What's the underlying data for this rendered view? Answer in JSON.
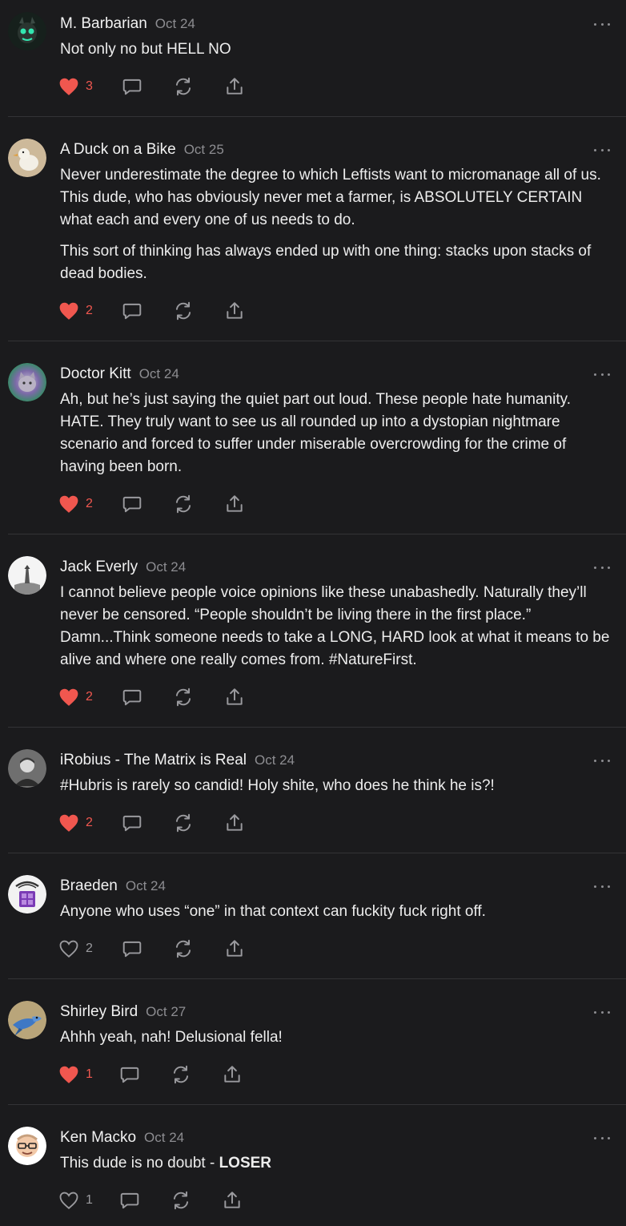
{
  "colors": {
    "background": "#1b1b1d",
    "liked_heart": "#f0574f",
    "icon_gray": "#9a9a9e",
    "date_gray": "#8d8d91",
    "divider": "#333336"
  },
  "comments": [
    {
      "author": "M. Barbarian",
      "date": "Oct 24",
      "paragraphs": [
        "Not only no but HELL NO"
      ],
      "likes": "3",
      "liked": true,
      "avatar": "skull-glow-avatar"
    },
    {
      "author": "A Duck on a Bike",
      "date": "Oct 25",
      "paragraphs": [
        "Never underestimate the degree to which Leftists want to micromanage all of us. This dude, who has obviously never met a farmer, is ABSOLUTELY CERTAIN what each and every one of us needs to do.",
        "This sort of thinking has always ended up with one thing: stacks upon stacks of dead bodies."
      ],
      "likes": "2",
      "liked": true,
      "avatar": "duck-avatar"
    },
    {
      "author": "Doctor Kitt",
      "date": "Oct 24",
      "paragraphs": [
        "Ah, but he’s just saying the quiet part out loud. These people hate humanity. HATE. They truly want to see us all rounded up into a dystopian nightmare scenario and forced to suffer under miserable overcrowding for the crime of having been born."
      ],
      "likes": "2",
      "liked": true,
      "avatar": "cat-avatar"
    },
    {
      "author": "Jack Everly",
      "date": "Oct 24",
      "paragraphs": [
        "I cannot believe people voice opinions like these unabashedly. Naturally they’ll never be censored. “People shouldn’t be living there in the first place.” Damn...Think someone needs to take a LONG, HARD look at what it means to be alive and where one really comes from. #NatureFirst."
      ],
      "likes": "2",
      "liked": true,
      "avatar": "lighthouse-avatar"
    },
    {
      "author": "iRobius - The Matrix is Real",
      "date": "Oct 24",
      "paragraphs": [
        "#Hubris is rarely so candid! Holy shite, who does he think he is?!"
      ],
      "likes": "2",
      "liked": true,
      "avatar": "portrait-avatar"
    },
    {
      "author": "Braeden",
      "date": "Oct 24",
      "paragraphs": [
        "Anyone who uses “one” in that context can fuckity fuck right off."
      ],
      "likes": "2",
      "liked": false,
      "avatar": "purple-crest-avatar"
    },
    {
      "author": "Shirley Bird",
      "date": "Oct 27",
      "paragraphs": [
        "Ahhh yeah, nah! Delusional fella!"
      ],
      "likes": "1",
      "liked": true,
      "avatar": "bluebird-avatar"
    },
    {
      "author": "Ken Macko",
      "date": "Oct 24",
      "paragraphs": [
        "This dude is no doubt - "
      ],
      "bold_suffix": "LOSER",
      "likes": "1",
      "liked": false,
      "avatar": "cartoon-face-avatar"
    }
  ]
}
